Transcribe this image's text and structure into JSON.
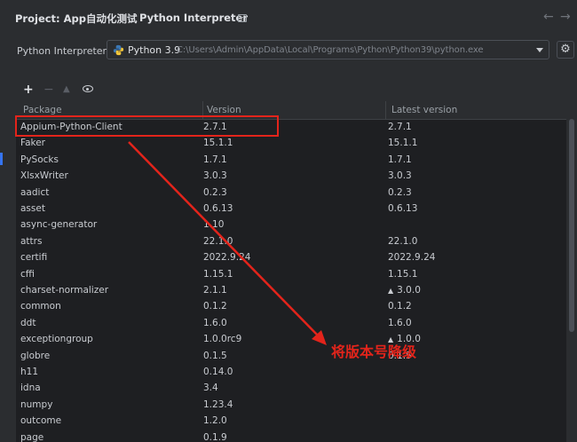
{
  "header": {
    "project_label": "Project: App自动化测试",
    "separator": "›",
    "title": "Python Interpreter",
    "back_arrow": "←",
    "forward_arrow": "→"
  },
  "interpreter": {
    "label": "Python Interpreter:",
    "name": "Python 3.9",
    "path": "C:\\Users\\Admin\\AppData\\Local\\Programs\\Python\\Python39\\python.exe"
  },
  "toolbar": {
    "add": "+",
    "remove": "−",
    "upgrade": "▲"
  },
  "table": {
    "columns": [
      "Package",
      "Version",
      "Latest version"
    ],
    "rows": [
      {
        "package": "Appium-Python-Client",
        "version": "2.7.1",
        "latest": "2.7.1",
        "upgrade": false
      },
      {
        "package": "Faker",
        "version": "15.1.1",
        "latest": "15.1.1",
        "upgrade": false
      },
      {
        "package": "PySocks",
        "version": "1.7.1",
        "latest": "1.7.1",
        "upgrade": false
      },
      {
        "package": "XlsxWriter",
        "version": "3.0.3",
        "latest": "3.0.3",
        "upgrade": false
      },
      {
        "package": "aadict",
        "version": "0.2.3",
        "latest": "0.2.3",
        "upgrade": false
      },
      {
        "package": "asset",
        "version": "0.6.13",
        "latest": "0.6.13",
        "upgrade": false
      },
      {
        "package": "async-generator",
        "version": "1.10",
        "latest": "",
        "upgrade": false
      },
      {
        "package": "attrs",
        "version": "22.1.0",
        "latest": "22.1.0",
        "upgrade": false
      },
      {
        "package": "certifi",
        "version": "2022.9.24",
        "latest": "2022.9.24",
        "upgrade": false
      },
      {
        "package": "cffi",
        "version": "1.15.1",
        "latest": "1.15.1",
        "upgrade": false
      },
      {
        "package": "charset-normalizer",
        "version": "2.1.1",
        "latest": "3.0.0",
        "upgrade": true
      },
      {
        "package": "common",
        "version": "0.1.2",
        "latest": "0.1.2",
        "upgrade": false
      },
      {
        "package": "ddt",
        "version": "1.6.0",
        "latest": "1.6.0",
        "upgrade": false
      },
      {
        "package": "exceptiongroup",
        "version": "1.0.0rc9",
        "latest": "1.0.0",
        "upgrade": true
      },
      {
        "package": "globre",
        "version": "0.1.5",
        "latest": "0.1.5",
        "upgrade": false
      },
      {
        "package": "h11",
        "version": "0.14.0",
        "latest": "",
        "upgrade": false
      },
      {
        "package": "idna",
        "version": "3.4",
        "latest": "",
        "upgrade": false
      },
      {
        "package": "numpy",
        "version": "1.23.4",
        "latest": "",
        "upgrade": false
      },
      {
        "package": "outcome",
        "version": "1.2.0",
        "latest": "",
        "upgrade": false
      },
      {
        "package": "page",
        "version": "0.1.9",
        "latest": "",
        "upgrade": false
      }
    ]
  },
  "annotation": {
    "text": "将版本号降级",
    "color": "#e3241b"
  },
  "colors": {
    "background": "#2b2d30",
    "table_bg": "#1e1f22",
    "accent": "#3574f0"
  }
}
